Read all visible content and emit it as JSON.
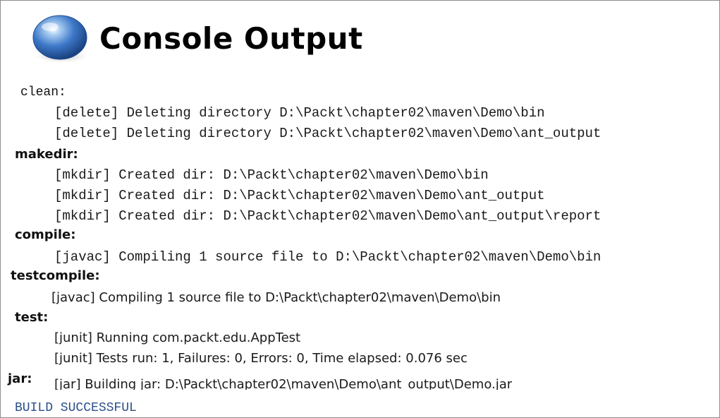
{
  "title": "Console Output",
  "icon": "blue-ball-icon",
  "colors": {
    "build_status": "#2b4f8a",
    "ball": "#3e78c8"
  },
  "console": {
    "clean_target": "clean:",
    "delete_bin": "[delete] Deleting directory D:\\Packt\\chapter02\\maven\\Demo\\bin",
    "delete_ant_output": "[delete] Deleting directory D:\\Packt\\chapter02\\maven\\Demo\\ant_output",
    "makedir_target": "makedir:",
    "mkdir_bin": "[mkdir] Created dir: D:\\Packt\\chapter02\\maven\\Demo\\bin",
    "mkdir_ant_output": "[mkdir] Created dir: D:\\Packt\\chapter02\\maven\\Demo\\ant_output",
    "mkdir_report": "[mkdir] Created dir: D:\\Packt\\chapter02\\maven\\Demo\\ant_output\\report",
    "compile_target": "compile:",
    "javac_compile": "[javac] Compiling 1 source file to D:\\Packt\\chapter02\\maven\\Demo\\bin",
    "testcompile_target": "testcompile:",
    "javac_testcompile": "[javac] Compiling 1 source file to D:\\Packt\\chapter02\\maven\\Demo\\bin",
    "test_target": "test:",
    "junit_running": "[junit] Running com.packt.edu.AppTest",
    "junit_results": "[junit] Tests run: 1, Failures: 0, Errors: 0, Time elapsed: 0.076 sec",
    "jar_target": "jar:",
    "jar_building": "[jar] Building jar: D:\\Packt\\chapter02\\maven\\Demo\\ant_output\\Demo.jar",
    "build_status": "BUILD SUCCESSFUL"
  }
}
